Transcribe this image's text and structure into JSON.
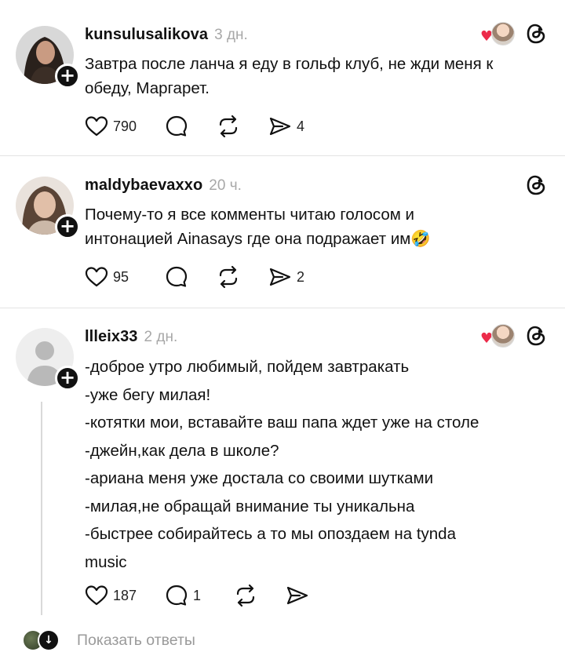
{
  "posts": [
    {
      "username": "kunsulusalikova",
      "time": "3 дн.",
      "lines": [
        "Завтра после ланча я еду в гольф клуб,  не жди меня к",
        "обеду, Маргарет."
      ],
      "likes": "790",
      "replies": "",
      "shares": "4"
    },
    {
      "username": "maldybaevaxxo",
      "time": "20 ч.",
      "lines": [
        "Почему-то я все комменты читаю голосом и",
        "интонацией Ainasays где она подражает им🤣"
      ],
      "likes": "95",
      "replies": "",
      "shares": "2"
    },
    {
      "username": "llleix33",
      "time": "2 дн.",
      "lines": [
        "-доброе утро любимый, пойдем завтракать",
        "-уже бегу милая!",
        "-котятки мои, вставайте ваш папа ждет уже на столе",
        "-джейн,как дела в школе?",
        "-ариана меня уже достала со своими шутками",
        "-милая,не обращай внимание ты уникальна",
        "-быстрее собирайтесь а то мы опоздаем на tynda",
        "music"
      ],
      "likes": "187",
      "replies": "1",
      "shares": ""
    }
  ],
  "show_replies_label": "Показать ответы",
  "icons": {
    "threads": "threads-logo-icon",
    "like": "heart-outline-icon",
    "reply": "comment-bubble-icon",
    "repost": "repost-arrows-icon",
    "share": "send-icon",
    "add": "plus-icon",
    "replies_toggle": "chevron-down-icon"
  },
  "colors": {
    "text": "#111111",
    "muted": "#a8a8a8",
    "heart": "#ec2b4a",
    "divider": "#e3e3e3"
  }
}
